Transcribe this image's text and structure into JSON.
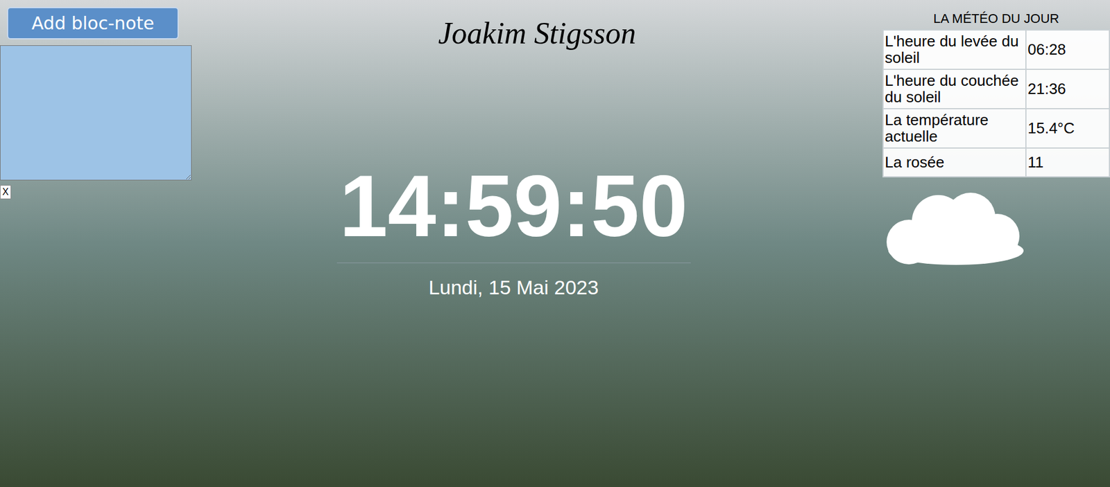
{
  "note_panel": {
    "add_button": "Add bloc-note",
    "note_text": "",
    "close_button": "X"
  },
  "title": "Joakim Stigsson",
  "clock": {
    "time": "14:59:50",
    "date": "Lundi, 15 Mai 2023"
  },
  "weather": {
    "heading": "LA MÉTÉO DU JOUR",
    "rows": [
      {
        "label": "L'heure du levée du soleil",
        "value": "06:28"
      },
      {
        "label": "L'heure du couchée du soleil",
        "value": "21:36"
      },
      {
        "label": "La température actuelle",
        "value": "15.4°C"
      },
      {
        "label": "La rosée",
        "value": "11"
      }
    ]
  }
}
